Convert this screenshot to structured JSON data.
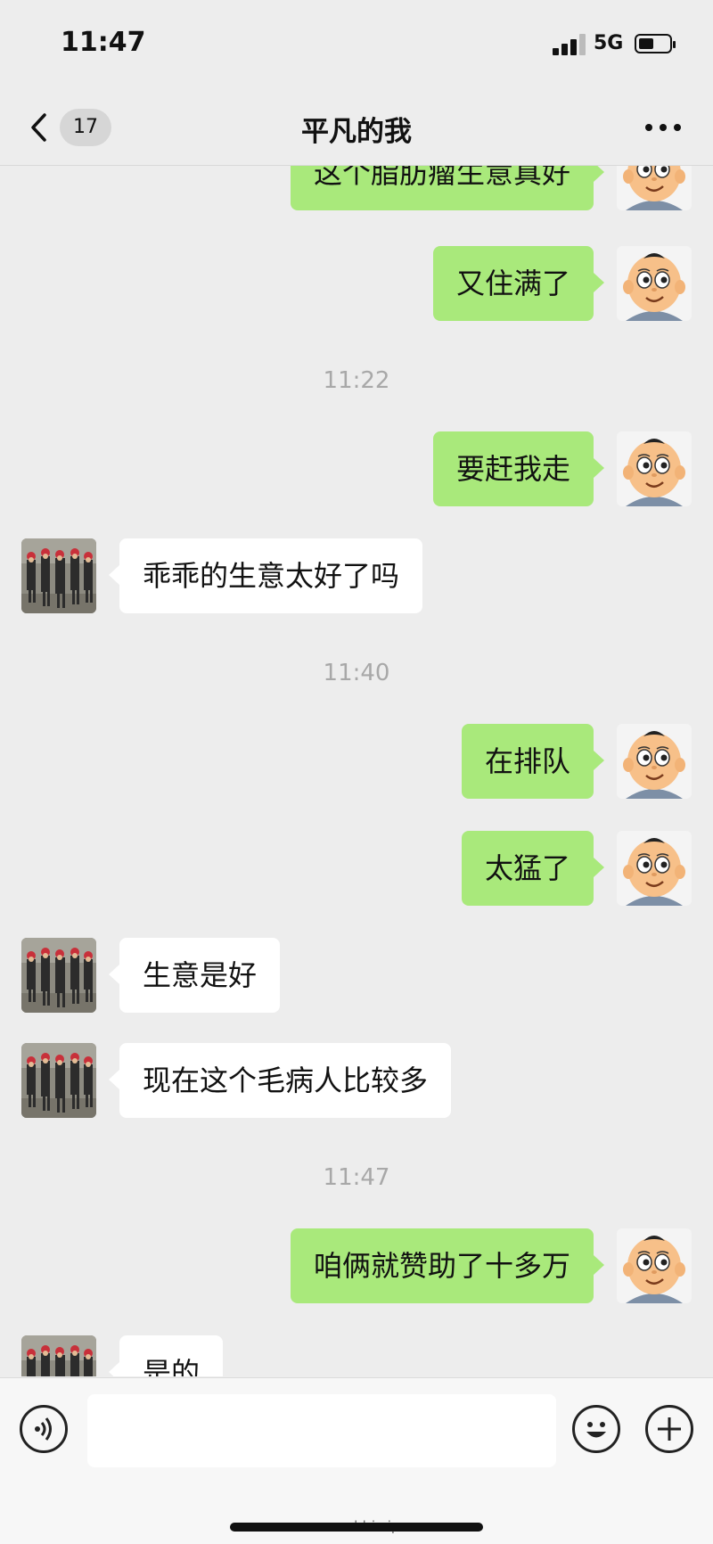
{
  "status_bar": {
    "time": "11:47",
    "network": "5G"
  },
  "header": {
    "unread_count": "17",
    "title": "平凡的我"
  },
  "messages": {
    "m1": "这个脂肪瘤生意真好",
    "m2": "又住满了",
    "t1": "11:22",
    "m3": "要赶我走",
    "m4": "乖乖的生意太好了吗",
    "t2": "11:40",
    "m5": "在排队",
    "m6": "太猛了",
    "m7": "生意是好",
    "m8": "现在这个毛病人比较多",
    "t3": "11:47",
    "m9": "咱俩就赞助了十多万",
    "m10": "是的"
  },
  "input_bar": {
    "placeholder": "",
    "watermark": "www.ddri.vip"
  },
  "colors": {
    "outgoing_bubble": "#a9e97b",
    "incoming_bubble": "#ffffff",
    "background": "#ededed"
  }
}
